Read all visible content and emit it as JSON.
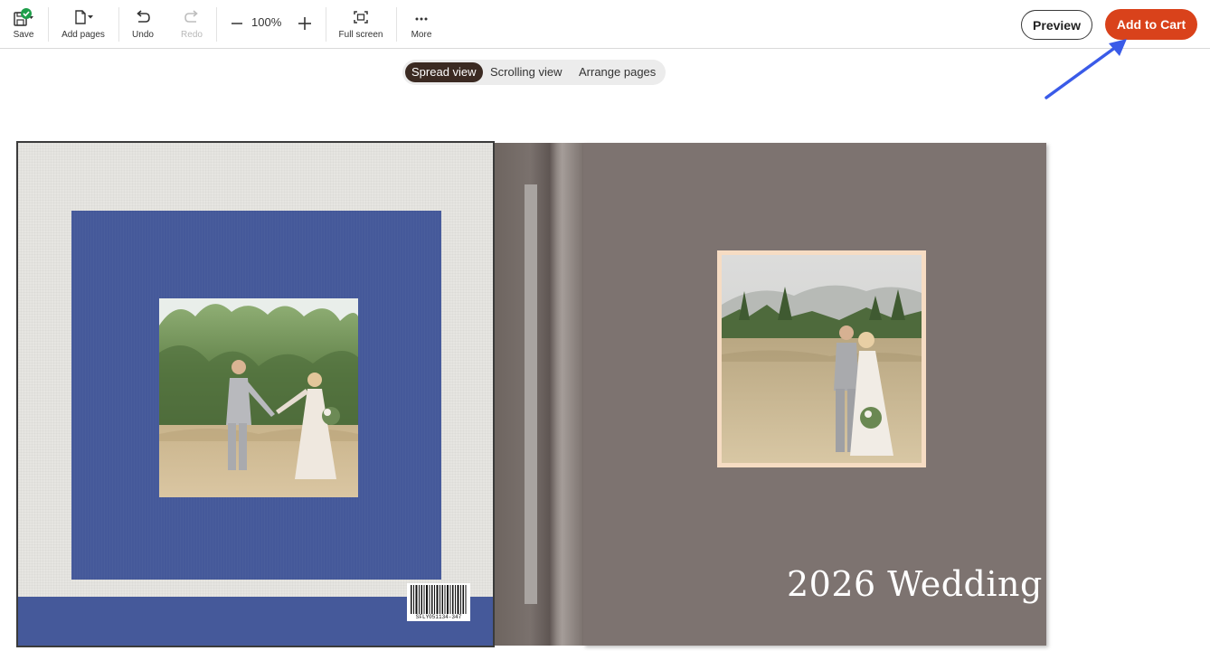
{
  "toolbar": {
    "save_label": "Save",
    "add_pages_label": "Add pages",
    "undo_label": "Undo",
    "redo_label": "Redo",
    "zoom_level": "100%",
    "full_screen_label": "Full screen",
    "more_label": "More"
  },
  "header_actions": {
    "preview_label": "Preview",
    "add_to_cart_label": "Add to Cart"
  },
  "view_switcher": {
    "options": [
      "Spread view",
      "Scrolling view",
      "Arrange pages"
    ],
    "active": "Spread view"
  },
  "book": {
    "cover_title": "2026 Wedding",
    "barcode_text": "SFLY051134-347"
  },
  "colors": {
    "accent_cart": "#d9421b",
    "back_cover_blue": "#45599a",
    "front_cover": "#7d7370",
    "photo_frame": "#f6dcc3",
    "annotation_arrow": "#3a5be8",
    "save_check": "#1e9e4a"
  },
  "icons": {
    "save": "save-icon",
    "add_pages": "add-page-icon",
    "undo": "undo-icon",
    "redo": "redo-icon",
    "zoom_out": "minus-icon",
    "zoom_in": "plus-icon",
    "full_screen": "full-screen-icon",
    "more": "more-icon"
  }
}
